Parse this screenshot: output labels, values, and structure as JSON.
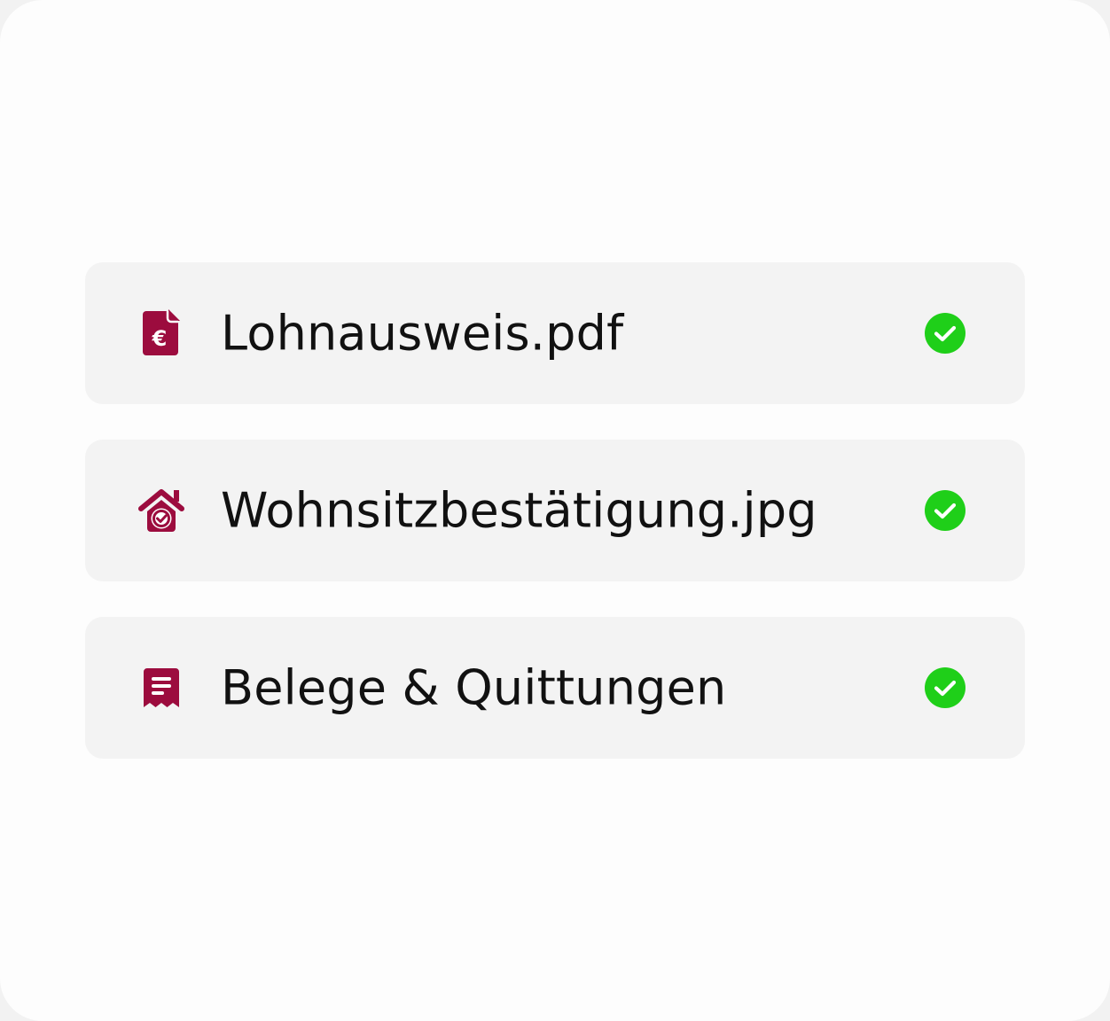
{
  "colors": {
    "icon_accent": "#9c0c3e",
    "status_success": "#1fcf19",
    "row_background": "#f3f3f3",
    "text": "#111111"
  },
  "documents": [
    {
      "name": "Lohnausweis.pdf",
      "icon": "euro-document-icon",
      "status": "uploaded",
      "status_icon": "check-circle-icon"
    },
    {
      "name": "Wohnsitzbestätigung.jpg",
      "icon": "house-check-icon",
      "status": "uploaded",
      "status_icon": "check-circle-icon"
    },
    {
      "name": "Belege & Quittungen",
      "icon": "receipt-icon",
      "status": "uploaded",
      "status_icon": "check-circle-icon"
    }
  ]
}
